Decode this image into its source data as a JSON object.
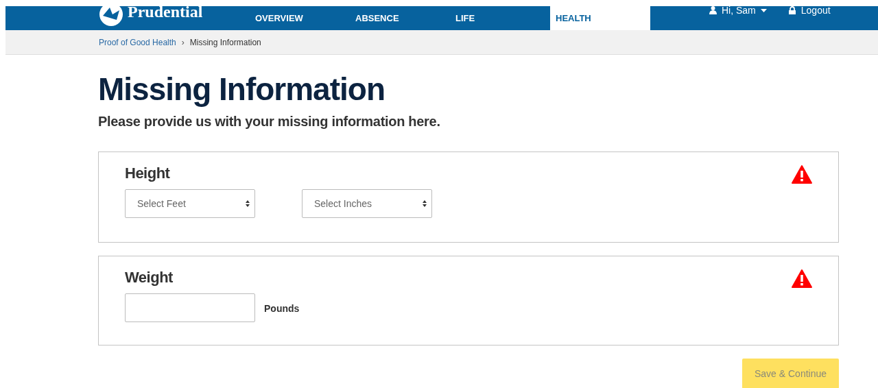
{
  "header": {
    "logo": "Prudential",
    "nav": [
      {
        "label": "OVERVIEW",
        "selected": false
      },
      {
        "label": "ABSENCE",
        "selected": false
      },
      {
        "label": "LIFE",
        "selected": false
      },
      {
        "label": "HEALTH",
        "selected": true
      }
    ],
    "user": "Hi, Sam",
    "logout": "Logout"
  },
  "breadcrumb": [
    {
      "label": "Proof of Good Health",
      "kind": "link"
    },
    {
      "label": "Missing Information",
      "kind": "current"
    }
  ],
  "breadcrumb_separator": "›",
  "title": "Missing Information",
  "subtitle": "Please provide us with your missing information here.",
  "sections": [
    {
      "title": "Height",
      "kind": "selects",
      "warning": true,
      "selects": [
        {
          "placeholder": "Select Feet"
        },
        {
          "placeholder": "Select Inches"
        }
      ]
    },
    {
      "title": "Weight",
      "kind": "input",
      "warning": true,
      "unit": "Pounds"
    }
  ],
  "submit": {
    "label": "Save & Continue",
    "disabled": true
  }
}
